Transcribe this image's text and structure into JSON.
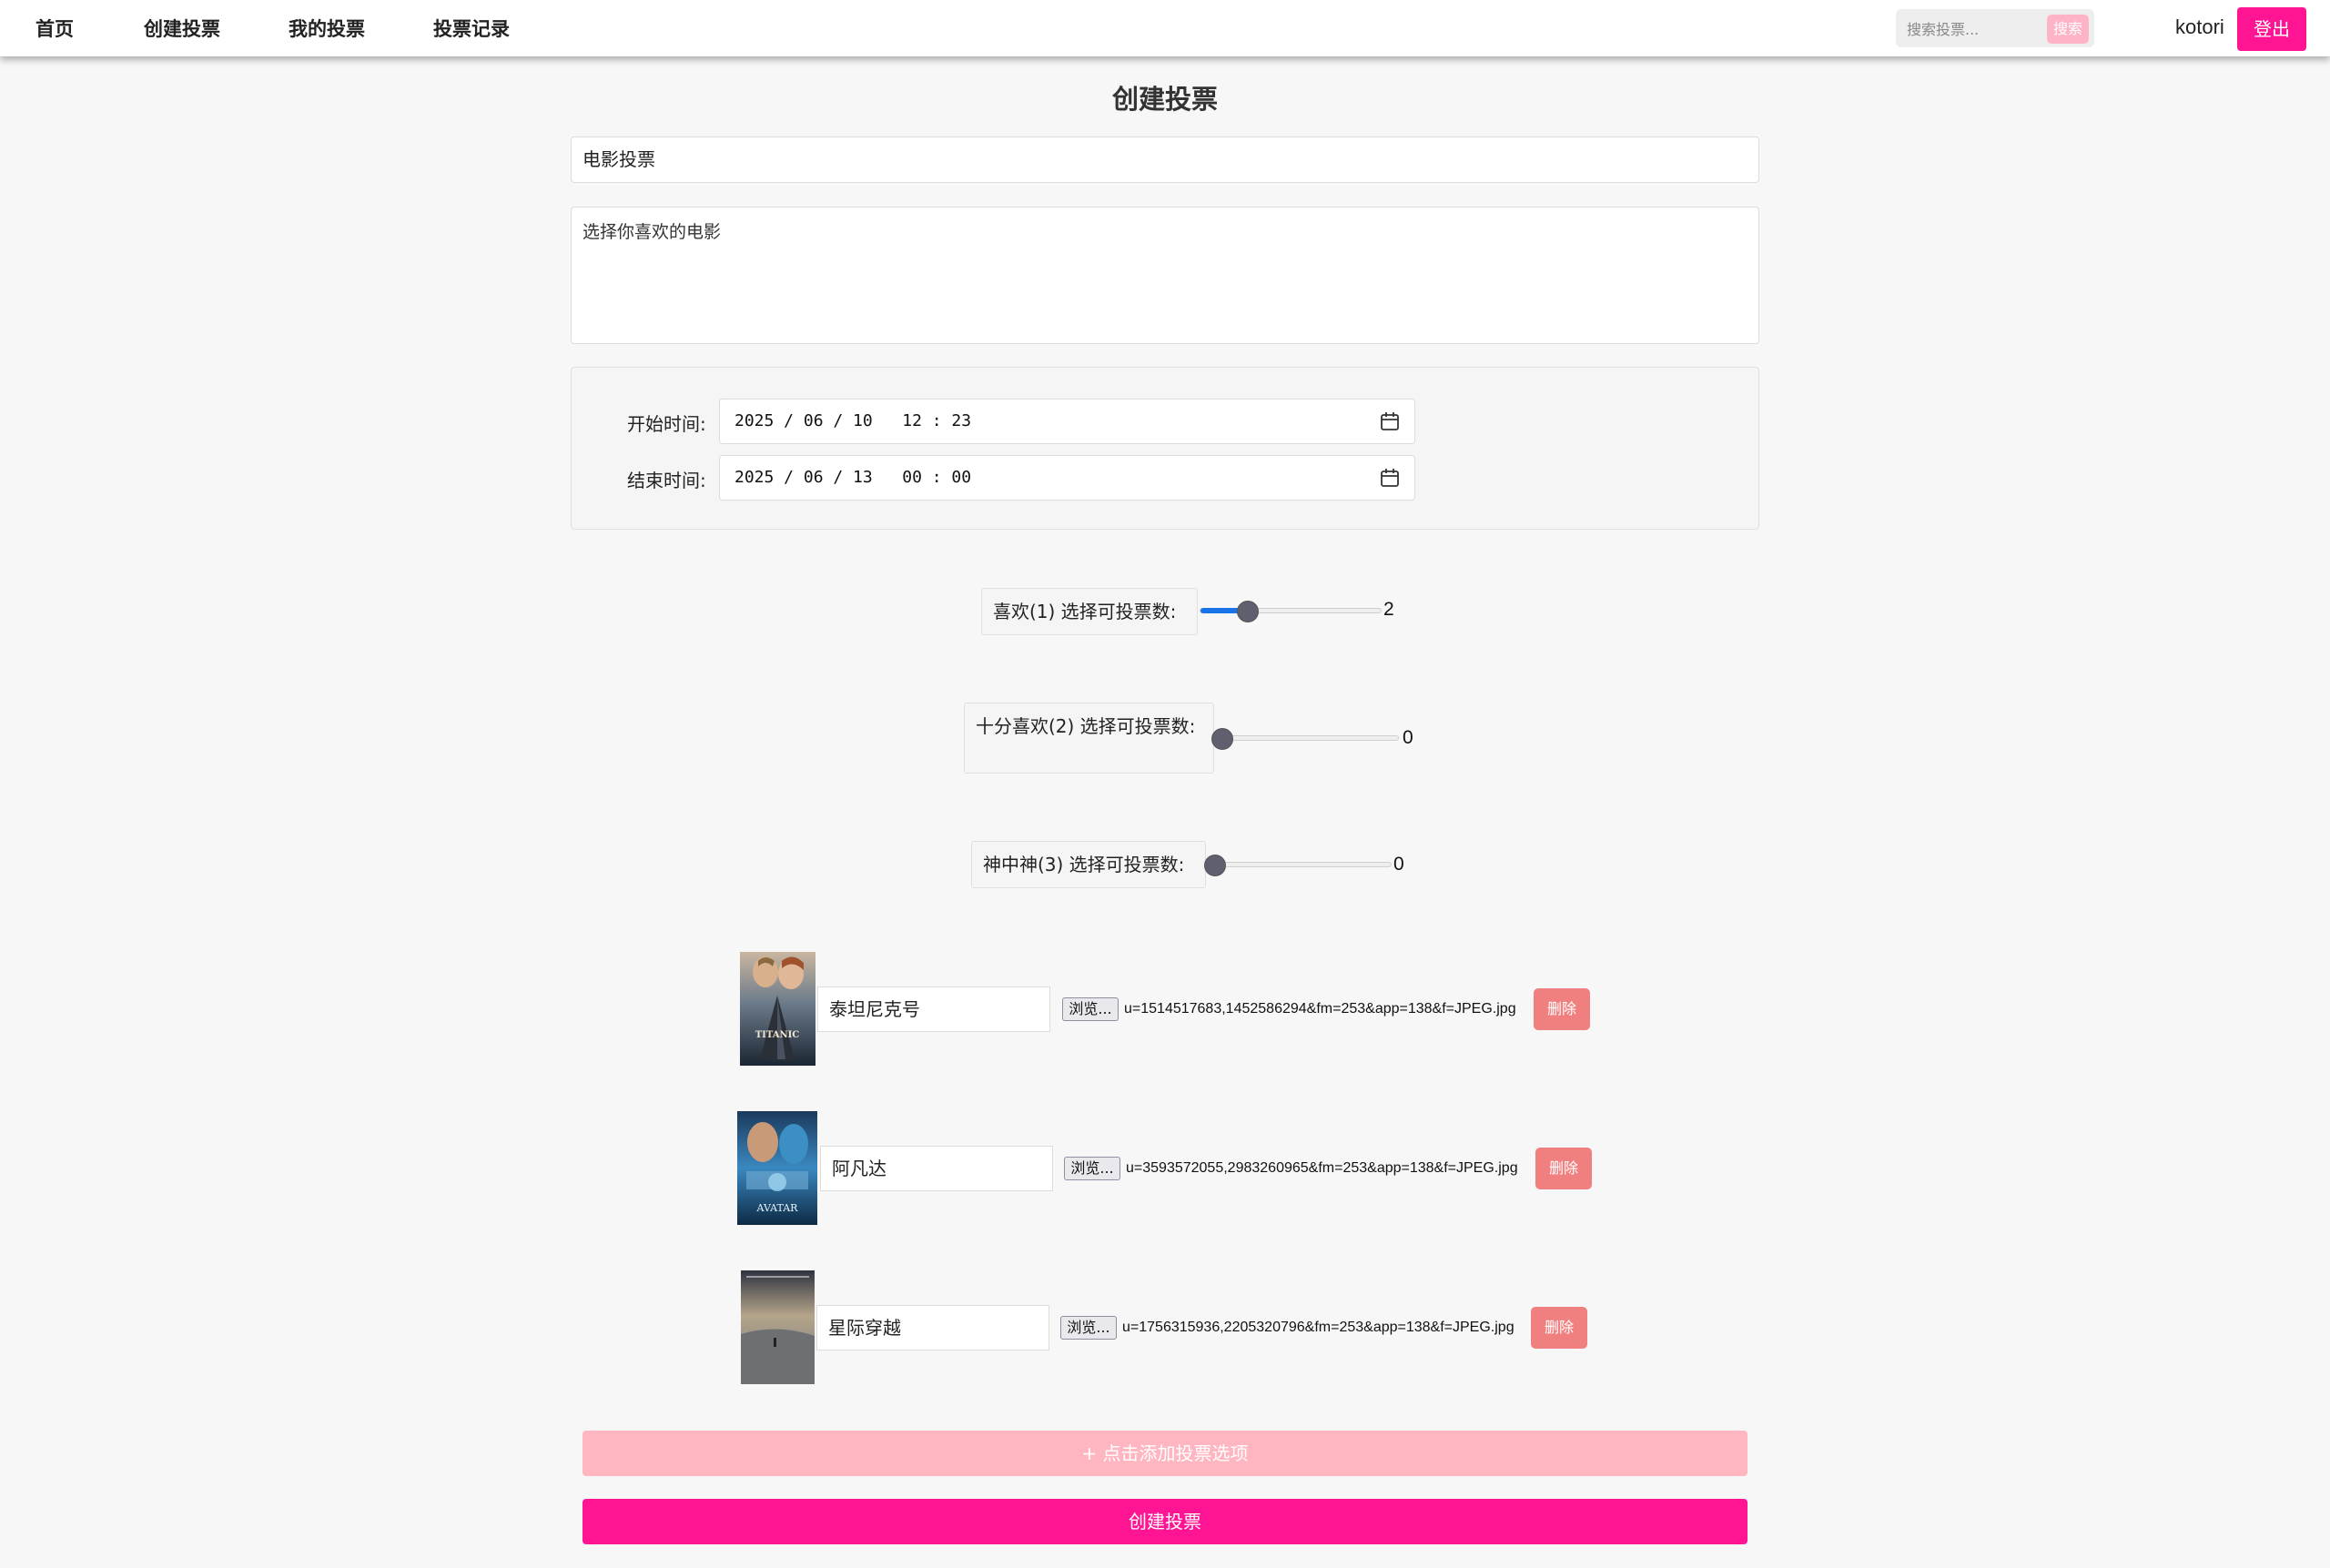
{
  "nav": {
    "items": [
      "首页",
      "创建投票",
      "我的投票",
      "投票记录"
    ],
    "search_placeholder": "搜索投票...",
    "search_button": "搜索",
    "username": "kotori",
    "logout": "登出"
  },
  "form": {
    "title": "创建投票",
    "poll_title": "电影投票",
    "description": "选择你喜欢的电影",
    "start_label": "开始时间:",
    "start_value": "2025 / 06 / 10   12 : 23",
    "end_label": "结束时间:",
    "end_value": "2025 / 06 / 13   00 : 00"
  },
  "sliders": [
    {
      "label": "喜欢(1) 选择可投票数:",
      "value": "2",
      "fraction": 0.25
    },
    {
      "label": "十分喜欢(2) 选择可投票数:",
      "value": "0",
      "fraction": 0
    },
    {
      "label": "神中神(3) 选择可投票数:",
      "value": "0",
      "fraction": 0
    }
  ],
  "options": [
    {
      "name": "泰坦尼克号",
      "poster_text": "TITANIC",
      "browse": "浏览...",
      "file": "u=1514517683,1452586294&fm=253&app=138&f=JPEG.jpg",
      "delete": "删除"
    },
    {
      "name": "阿凡达",
      "poster_text": "AVATAR",
      "browse": "浏览...",
      "file": "u=3593572055,2983260965&fm=253&app=138&f=JPEG.jpg",
      "delete": "删除"
    },
    {
      "name": "星际穿越",
      "poster_text": "",
      "browse": "浏览...",
      "file": "u=1756315936,2205320796&fm=253&app=138&f=JPEG.jpg",
      "delete": "删除"
    }
  ],
  "actions": {
    "add_option": "+ 点击添加投票选项",
    "create": "创建投票"
  },
  "colors": {
    "primary": "#ff1493",
    "primary_light": "#ffb6c1",
    "delete": "#f08080",
    "slider_fill": "#1a73e8"
  }
}
